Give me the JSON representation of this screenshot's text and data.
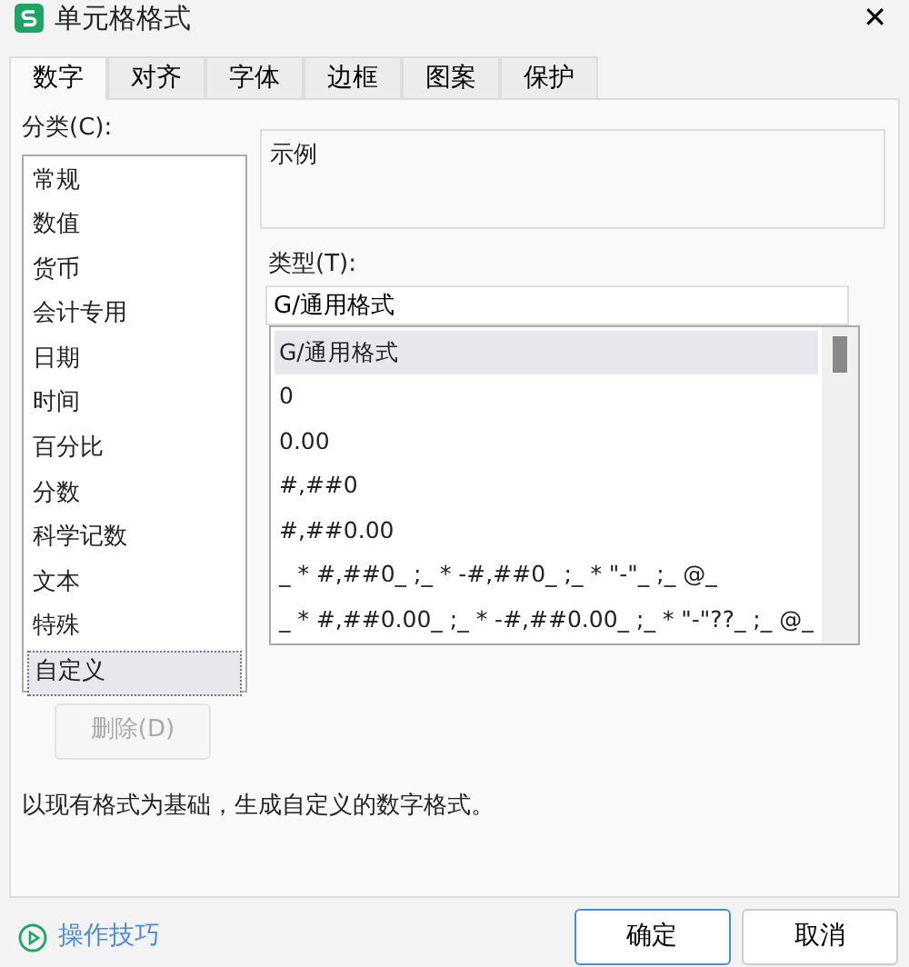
{
  "window": {
    "title": "单元格格式",
    "close": "✕"
  },
  "tabs": [
    {
      "label": "数字",
      "selected": true
    },
    {
      "label": "对齐",
      "selected": false
    },
    {
      "label": "字体",
      "selected": false
    },
    {
      "label": "边框",
      "selected": false
    },
    {
      "label": "图案",
      "selected": false
    },
    {
      "label": "保护",
      "selected": false
    }
  ],
  "category": {
    "label": "分类(C):",
    "items": [
      {
        "label": "常规",
        "selected": false
      },
      {
        "label": "数值",
        "selected": false
      },
      {
        "label": "货币",
        "selected": false
      },
      {
        "label": "会计专用",
        "selected": false
      },
      {
        "label": "日期",
        "selected": false
      },
      {
        "label": "时间",
        "selected": false
      },
      {
        "label": "百分比",
        "selected": false
      },
      {
        "label": "分数",
        "selected": false
      },
      {
        "label": "科学记数",
        "selected": false
      },
      {
        "label": "文本",
        "selected": false
      },
      {
        "label": "特殊",
        "selected": false
      },
      {
        "label": "自定义",
        "selected": true
      }
    ]
  },
  "sample": {
    "label": "示例"
  },
  "type": {
    "label": "类型(T):",
    "value": "G/通用格式",
    "items": [
      {
        "label": "G/通用格式",
        "selected": true
      },
      {
        "label": "0",
        "selected": false
      },
      {
        "label": "0.00",
        "selected": false
      },
      {
        "label": "#,##0",
        "selected": false
      },
      {
        "label": "#,##0.00",
        "selected": false
      },
      {
        "label": "_ * #,##0_ ;_ * -#,##0_ ;_ * \"-\"_ ;_ @_",
        "selected": false
      },
      {
        "label": "_ * #,##0.00_ ;_ * -#,##0.00_ ;_ * \"-\"??_ ;_ @_",
        "selected": false
      }
    ]
  },
  "delete_button": {
    "label": "删除(D)",
    "disabled": true
  },
  "description": "以现有格式为基础，生成自定义的数字格式。",
  "tips_link": "操作技巧",
  "buttons": [
    {
      "label": "确定",
      "kind": "primary"
    },
    {
      "label": "取消",
      "kind": "secondary"
    }
  ]
}
